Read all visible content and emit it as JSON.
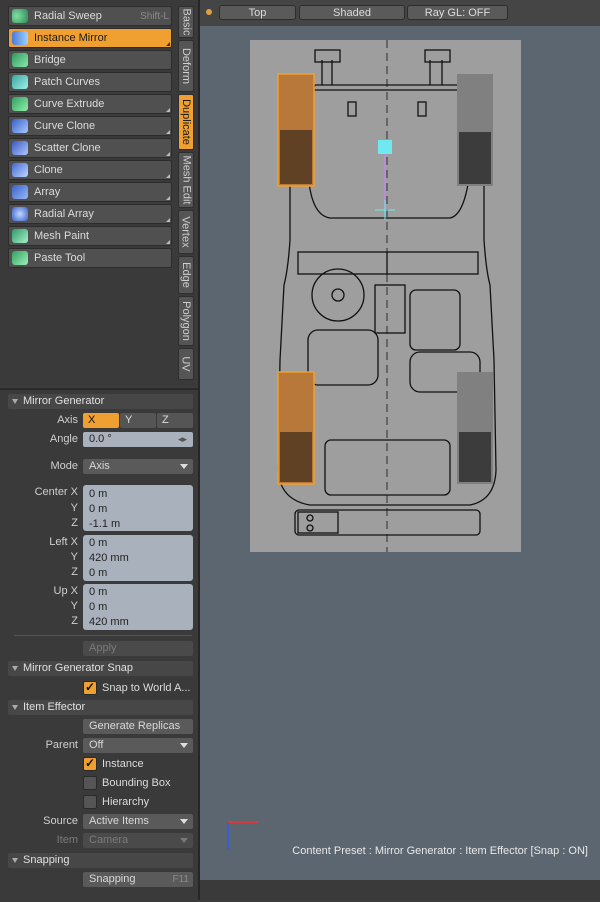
{
  "tools": [
    {
      "label": "Radial Sweep",
      "shortcut": "Shift-L",
      "icon": "radial-sweep-icon",
      "active": false,
      "submenu": false
    },
    {
      "label": "Instance Mirror",
      "shortcut": "",
      "icon": "instance-mirror-icon",
      "active": true,
      "submenu": true
    },
    {
      "label": "Bridge",
      "shortcut": "",
      "icon": "bridge-icon",
      "active": false,
      "submenu": false
    },
    {
      "label": "Patch Curves",
      "shortcut": "",
      "icon": "patch-curves-icon",
      "active": false,
      "submenu": false
    },
    {
      "label": "Curve Extrude",
      "shortcut": "",
      "icon": "curve-extrude-icon",
      "active": false,
      "submenu": true
    },
    {
      "label": "Curve Clone",
      "shortcut": "",
      "icon": "curve-clone-icon",
      "active": false,
      "submenu": true
    },
    {
      "label": "Scatter Clone",
      "shortcut": "",
      "icon": "scatter-clone-icon",
      "active": false,
      "submenu": true
    },
    {
      "label": "Clone",
      "shortcut": "",
      "icon": "clone-icon",
      "active": false,
      "submenu": true
    },
    {
      "label": "Array",
      "shortcut": "",
      "icon": "array-icon",
      "active": false,
      "submenu": true
    },
    {
      "label": "Radial Array",
      "shortcut": "",
      "icon": "radial-array-icon",
      "active": false,
      "submenu": true
    },
    {
      "label": "Mesh Paint",
      "shortcut": "",
      "icon": "mesh-paint-icon",
      "active": false,
      "submenu": true
    },
    {
      "label": "Paste Tool",
      "shortcut": "",
      "icon": "paste-tool-icon",
      "active": false,
      "submenu": false
    }
  ],
  "side_tabs": [
    {
      "label": "Basic",
      "active": false
    },
    {
      "label": "Deform",
      "active": false
    },
    {
      "label": "Duplicate",
      "active": true
    },
    {
      "label": "Mesh Edit",
      "active": false
    },
    {
      "label": "Vertex",
      "active": false
    },
    {
      "label": "Edge",
      "active": false
    },
    {
      "label": "Polygon",
      "active": false
    },
    {
      "label": "UV",
      "active": false
    }
  ],
  "mirror_generator": {
    "section": "Mirror Generator",
    "axis_label": "Axis",
    "axis_options": [
      "X",
      "Y",
      "Z"
    ],
    "axis_selected": "X",
    "angle_label": "Angle",
    "angle_value": "0.0 °",
    "mode_label": "Mode",
    "mode_value": "Axis",
    "center": {
      "label_x": "Center X",
      "label_y": "Y",
      "label_z": "Z",
      "x": "0 m",
      "y": "0 m",
      "z": "-1.1 m"
    },
    "left": {
      "label_x": "Left X",
      "label_y": "Y",
      "label_z": "Z",
      "x": "0 m",
      "y": "420 mm",
      "z": "0 m"
    },
    "up": {
      "label_x": "Up X",
      "label_y": "Y",
      "label_z": "Z",
      "x": "0 m",
      "y": "0 m",
      "z": "420 mm"
    },
    "apply_label": "Apply"
  },
  "mirror_snap": {
    "section": "Mirror Generator Snap",
    "snap_label": "Snap to World A...",
    "snap_checked": true
  },
  "item_effector": {
    "section": "Item Effector",
    "generate_label": "Generate Replicas",
    "parent_label": "Parent",
    "parent_value": "Off",
    "instance_label": "Instance",
    "instance_checked": true,
    "bounding_label": "Bounding Box",
    "bounding_checked": false,
    "hierarchy_label": "Hierarchy",
    "hierarchy_checked": false,
    "source_label": "Source",
    "source_value": "Active Items",
    "item_label": "Item",
    "item_value": "Camera"
  },
  "snapping": {
    "section": "Snapping",
    "button_label": "Snapping",
    "button_shortcut": "F11"
  },
  "viewport": {
    "view_label": "Top",
    "shading_label": "Shaded",
    "raygl_label": "Ray GL: OFF",
    "status_text": "Content Preset : Mirror Generator : Item Effector  [Snap : ON]"
  },
  "colors": {
    "accent": "#f0a030",
    "viewport_bg": "#5c6670",
    "panel_bg": "#3a3a3a",
    "field_bg": "#a9b2bc"
  }
}
